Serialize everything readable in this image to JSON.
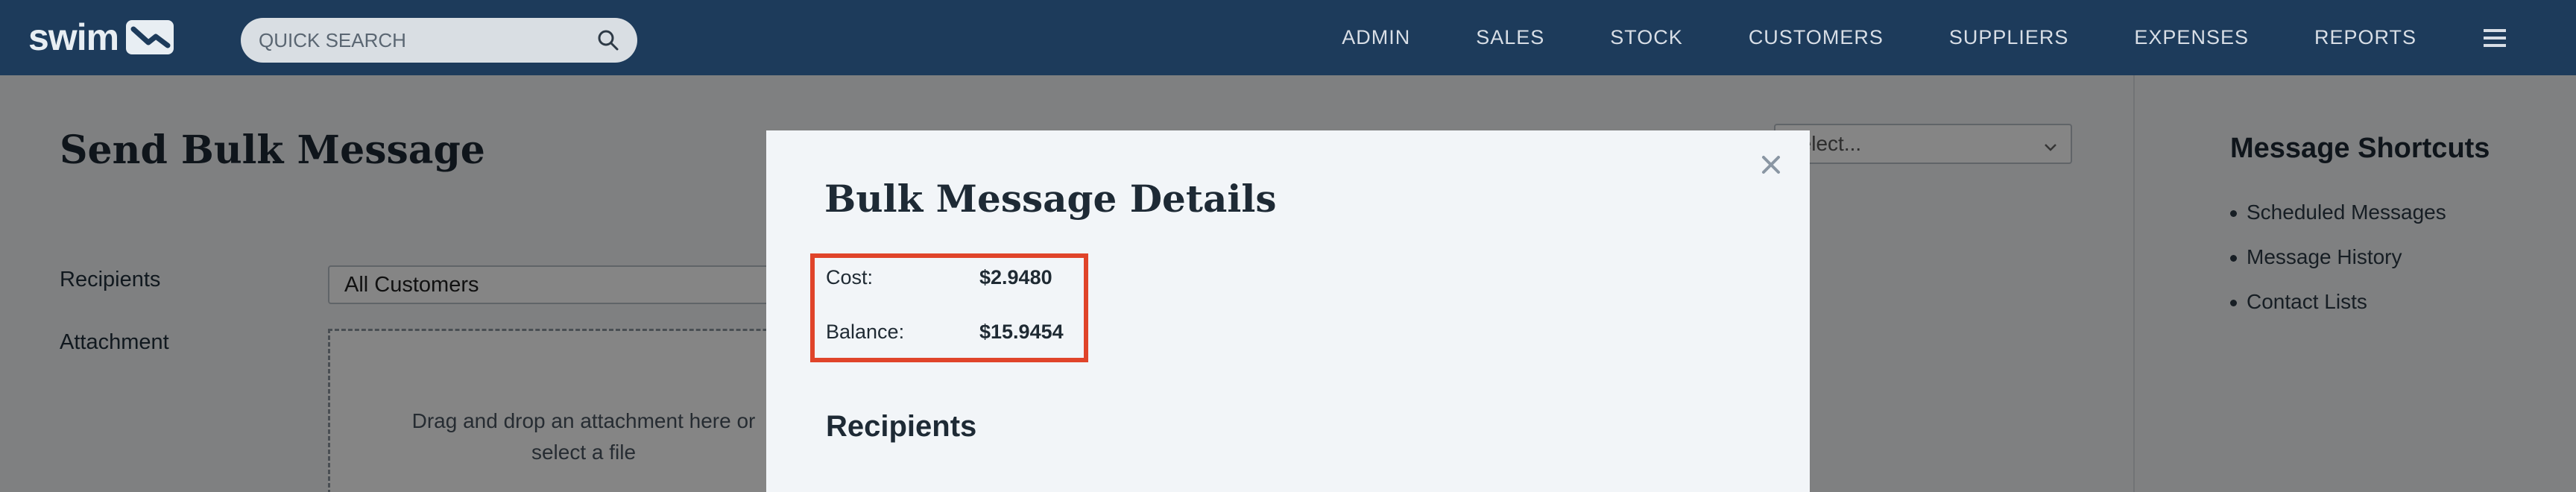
{
  "brand": {
    "name": "swim"
  },
  "search": {
    "placeholder": "QUICK SEARCH"
  },
  "nav": {
    "items": [
      "ADMIN",
      "SALES",
      "STOCK",
      "CUSTOMERS",
      "SUPPLIERS",
      "EXPENSES",
      "REPORTS"
    ]
  },
  "page": {
    "title": "Send Bulk Message",
    "recipients_label": "Recipients",
    "recipients_value": "All Customers",
    "attachment_label": "Attachment",
    "dropzone_text_1": "Drag and drop an attachment here or",
    "dropzone_text_2": "select a file",
    "select_placeholder": "Select..."
  },
  "shortcuts": {
    "title": "Message Shortcuts",
    "items": [
      "Scheduled Messages",
      "Message History",
      "Contact Lists"
    ]
  },
  "modal": {
    "title": "Bulk Message Details",
    "cost_label": "Cost:",
    "cost_value": "$2.9480",
    "balance_label": "Balance:",
    "balance_value": "$15.9454",
    "recipients_heading": "Recipients"
  },
  "colors": {
    "topbar": "#1d3b5b",
    "highlight": "#e0442a",
    "modal_bg": "#f2f5f8"
  }
}
